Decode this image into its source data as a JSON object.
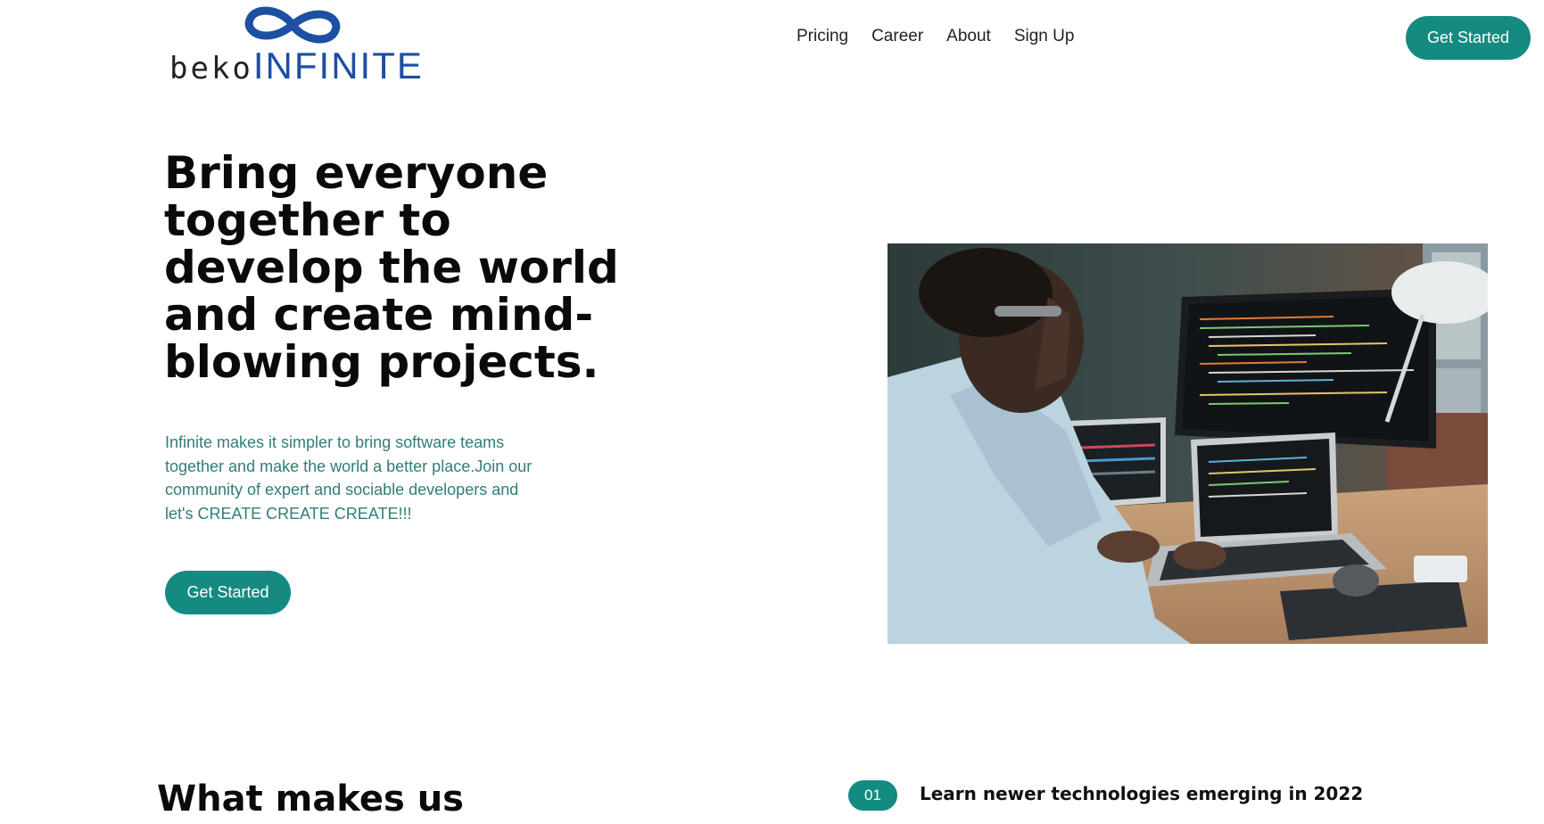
{
  "brand": {
    "logo_prefix": "beko",
    "logo_name": "INFINITE",
    "logo_icon": "infinity-icon",
    "colors": {
      "logo_blue": "#1d4fa3",
      "accent": "#138b80",
      "description_text": "#2f7e78"
    }
  },
  "nav": {
    "items": [
      {
        "label": "Pricing"
      },
      {
        "label": "Career"
      },
      {
        "label": "About"
      },
      {
        "label": "Sign Up"
      }
    ],
    "cta_label": "Get Started"
  },
  "hero": {
    "title": "Bring everyone together to develop the world and create mind-blowing projects.",
    "description": "Infinite makes it simpler to bring software teams together and make the world a better place.Join our community of expert and sociable developers and let's CREATE CREATE CREATE!!!",
    "cta_label": "Get Started"
  },
  "features": {
    "heading": "What makes us",
    "items": [
      {
        "number": "01",
        "title": "Learn newer technologies emerging in 2022"
      }
    ]
  }
}
